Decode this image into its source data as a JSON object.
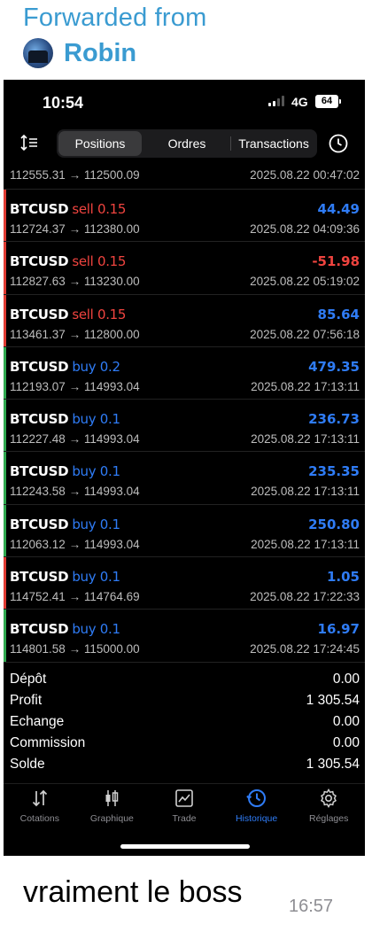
{
  "forward": {
    "label": "Forwarded from",
    "sender": "Robin"
  },
  "status_bar": {
    "time": "10:54",
    "network": "4G",
    "battery": "64"
  },
  "toolbar": {
    "tabs": [
      {
        "label": "Positions",
        "active": true
      },
      {
        "label": "Ordres",
        "active": false
      },
      {
        "label": "Transactions",
        "active": false
      }
    ]
  },
  "partial_row": {
    "prices": "112555.31 → 112500.09",
    "time": "2025.08.22 00:47:02"
  },
  "trades": [
    {
      "symbol": "BTCUSD",
      "side": "sell 0.15",
      "profit": "44.49",
      "prices": "112724.37 → 112380.00",
      "time": "2025.08.22 04:09:36",
      "positive": true
    },
    {
      "symbol": "BTCUSD",
      "side": "sell 0.15",
      "profit": "-51.98",
      "prices": "112827.63 → 113230.00",
      "time": "2025.08.22 05:19:02",
      "positive": false
    },
    {
      "symbol": "BTCUSD",
      "side": "sell 0.15",
      "profit": "85.64",
      "prices": "113461.37 → 112800.00",
      "time": "2025.08.22 07:56:18",
      "positive": true
    },
    {
      "symbol": "BTCUSD",
      "side": "buy 0.2",
      "profit": "479.35",
      "prices": "112193.07 → 114993.04",
      "time": "2025.08.22 17:13:11",
      "positive": true
    },
    {
      "symbol": "BTCUSD",
      "side": "buy 0.1",
      "profit": "236.73",
      "prices": "112227.48 → 114993.04",
      "time": "2025.08.22 17:13:11",
      "positive": true
    },
    {
      "symbol": "BTCUSD",
      "side": "buy 0.1",
      "profit": "235.35",
      "prices": "112243.58 → 114993.04",
      "time": "2025.08.22 17:13:11",
      "positive": true
    },
    {
      "symbol": "BTCUSD",
      "side": "buy 0.1",
      "profit": "250.80",
      "prices": "112063.12 → 114993.04",
      "time": "2025.08.22 17:13:11",
      "positive": true
    },
    {
      "symbol": "BTCUSD",
      "side": "buy 0.1",
      "profit": "1.05",
      "prices": "114752.41 → 114764.69",
      "time": "2025.08.22 17:22:33",
      "positive": true
    },
    {
      "symbol": "BTCUSD",
      "side": "buy 0.1",
      "profit": "16.97",
      "prices": "114801.58 → 115000.00",
      "time": "2025.08.22 17:24:45",
      "positive": true
    }
  ],
  "summary": [
    {
      "label": "Dépôt",
      "value": "0.00"
    },
    {
      "label": "Profit",
      "value": "1 305.54"
    },
    {
      "label": "Echange",
      "value": "0.00"
    },
    {
      "label": "Commission",
      "value": "0.00"
    },
    {
      "label": "Solde",
      "value": "1 305.54"
    }
  ],
  "tabbar": [
    {
      "label": "Cotations",
      "icon": "quotes-arrows-icon",
      "active": false
    },
    {
      "label": "Graphique",
      "icon": "candlestick-chart-icon",
      "active": false
    },
    {
      "label": "Trade",
      "icon": "trade-chart-icon",
      "active": false
    },
    {
      "label": "Historique",
      "icon": "history-clock-icon",
      "active": true
    },
    {
      "label": "Réglages",
      "icon": "gear-icon",
      "active": false
    }
  ],
  "colors": {
    "sell": "#f0443f",
    "buy": "#2f7cf6",
    "profit_positive": "#2f7cf6",
    "profit_negative": "#f0443f",
    "accent_green": "#2fa84f",
    "accent_red": "#e03b33",
    "forward_blue": "#3a9bd1"
  },
  "message": {
    "text": "vraiment le boss",
    "time": "16:57"
  }
}
